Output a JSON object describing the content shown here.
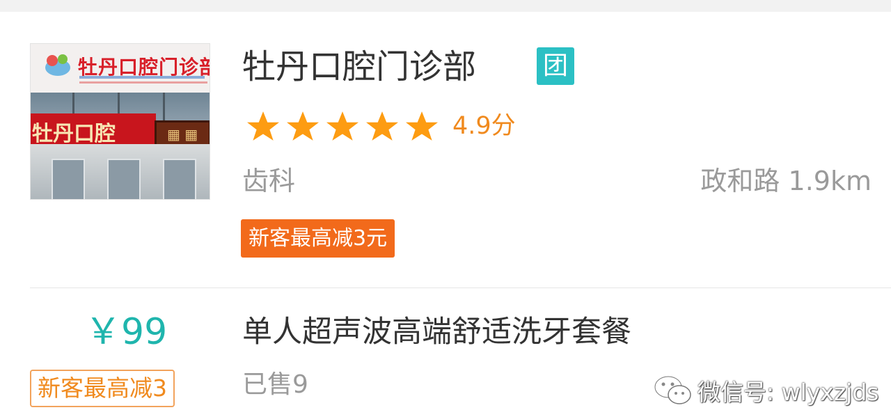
{
  "shop": {
    "name": "牡丹口腔门诊部",
    "group_buy_badge": "团",
    "rating": 4.9,
    "rating_text": "4.9分",
    "category": "齿科",
    "road": "政和路",
    "distance": "1.9km",
    "promo": "新客最高减3元",
    "photo_sign_text": "牡丹口腔门诊部",
    "photo_red_text": "牡丹口腔"
  },
  "deal": {
    "price": "￥99",
    "promo": "新客最高减3",
    "title": "单人超声波高端舒适洗牙套餐",
    "sold": "已售9"
  },
  "watermark": {
    "text": "微信号: wlyxzjds",
    "icon": "wechat-icon"
  },
  "colors": {
    "star": "#fd9c12",
    "score": "#f08a1e",
    "badge": "#2bc0c4",
    "promo_bg": "#f26a1b",
    "price": "#1fb5ad"
  }
}
